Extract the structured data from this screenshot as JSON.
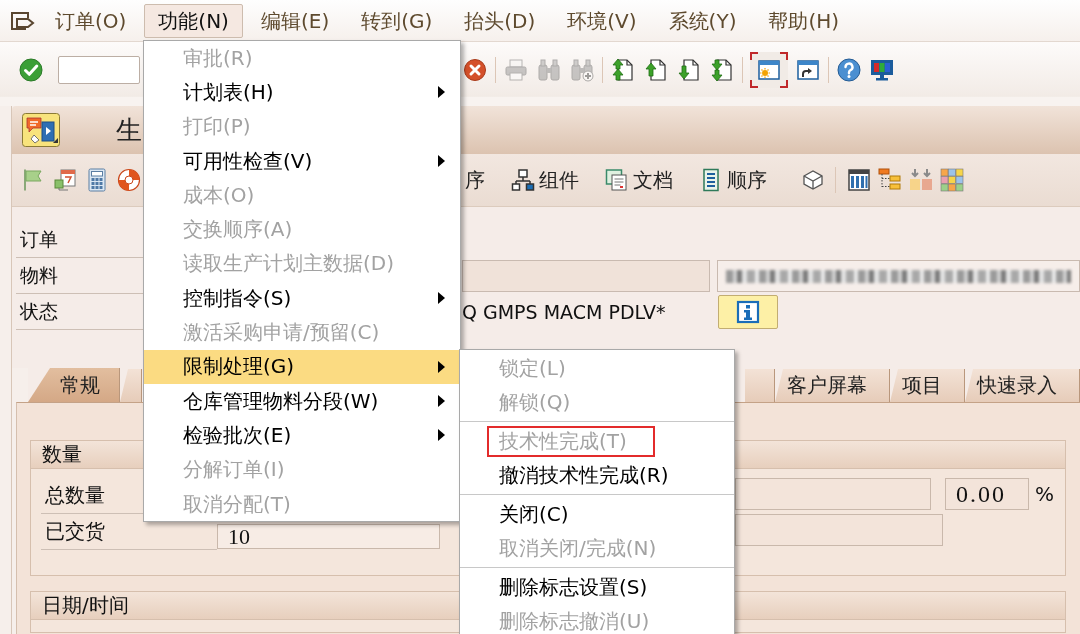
{
  "menu_bar": {
    "items": [
      {
        "label": "订单(O)",
        "selected": false
      },
      {
        "label": "功能(N)",
        "selected": true
      },
      {
        "label": "编辑(E)",
        "selected": false
      },
      {
        "label": "转到(G)",
        "selected": false
      },
      {
        "label": "抬头(D)",
        "selected": false
      },
      {
        "label": "环境(V)",
        "selected": false
      },
      {
        "label": "系统(Y)",
        "selected": false
      },
      {
        "label": "帮助(H)",
        "selected": false
      }
    ]
  },
  "toolbar": {
    "left": [
      {
        "kind": "enter",
        "disabled": false,
        "focused": false
      }
    ],
    "right": [
      {
        "kind": "cancel",
        "disabled": false,
        "focused": false
      },
      {
        "kind": "separator"
      },
      {
        "kind": "print",
        "disabled": true,
        "focused": false
      },
      {
        "kind": "find",
        "disabled": true,
        "focused": false
      },
      {
        "kind": "find-next",
        "disabled": true,
        "focused": false
      },
      {
        "kind": "separator"
      },
      {
        "kind": "first-page",
        "disabled": false,
        "focused": false
      },
      {
        "kind": "previous-page",
        "disabled": false,
        "focused": false
      },
      {
        "kind": "next-page",
        "disabled": false,
        "focused": false
      },
      {
        "kind": "last-page",
        "disabled": false,
        "focused": false
      },
      {
        "kind": "separator"
      },
      {
        "kind": "new-session",
        "disabled": false,
        "focused": true
      },
      {
        "kind": "shortcut",
        "disabled": false,
        "focused": false
      },
      {
        "kind": "separator"
      },
      {
        "kind": "help",
        "disabled": false,
        "focused": false
      },
      {
        "kind": "layout",
        "disabled": false,
        "focused": false
      }
    ]
  },
  "title_bar": {
    "title": "生"
  },
  "application_toolbar": {
    "left": [
      {
        "kind": "flag"
      },
      {
        "kind": "calendar-doc"
      },
      {
        "kind": "calculator"
      },
      {
        "kind": "lifebuoy"
      }
    ],
    "right": [
      {
        "kind": "text",
        "label": "序"
      },
      {
        "kind": "components",
        "label": "组件"
      },
      {
        "kind": "documents",
        "label": "文档"
      },
      {
        "kind": "sequence",
        "label": "顺序"
      },
      {
        "kind": "cube"
      },
      {
        "kind": "separator"
      },
      {
        "kind": "columns"
      },
      {
        "kind": "hierarchy"
      },
      {
        "kind": "arrows"
      },
      {
        "kind": "grid"
      }
    ]
  },
  "header": {
    "rows": [
      {
        "kind": "blank",
        "label": "订单"
      },
      {
        "kind": "fields",
        "label": "物料"
      },
      {
        "kind": "status",
        "label": "状态",
        "value": "Q GMPS MACM PDLV*"
      }
    ]
  },
  "tabs": [
    {
      "label": "常规",
      "selected": true
    },
    {
      "selected": false
    },
    {
      "selected": false
    },
    {
      "label": "客户屏幕",
      "selected": false
    },
    {
      "label": "项目",
      "selected": false
    },
    {
      "label": "快速录入",
      "selected": false
    }
  ],
  "quantity_group": {
    "title": "数量",
    "rows": [
      {
        "kind": "ratio",
        "label": "总数量",
        "value": "0.00",
        "unit": "%"
      },
      {
        "kind": "amount",
        "label": "已交货",
        "value": "10"
      }
    ]
  },
  "date_group": {
    "title": "日期/时间"
  },
  "function_menu": {
    "items": [
      {
        "label": "审批(R)",
        "disabled": true,
        "has_submenu": false,
        "selected": false
      },
      {
        "label": "计划表(H)",
        "disabled": false,
        "has_submenu": true,
        "selected": false
      },
      {
        "label": "打印(P)",
        "disabled": true,
        "has_submenu": false,
        "selected": false
      },
      {
        "label": "可用性检查(V)",
        "disabled": false,
        "has_submenu": true,
        "selected": false
      },
      {
        "label": "成本(O)",
        "disabled": true,
        "has_submenu": false,
        "selected": false
      },
      {
        "label": "交换顺序(A)",
        "disabled": true,
        "has_submenu": false,
        "selected": false
      },
      {
        "label": "读取生产计划主数据(D)",
        "disabled": true,
        "has_submenu": false,
        "selected": false
      },
      {
        "label": "控制指令(S)",
        "disabled": false,
        "has_submenu": true,
        "selected": false
      },
      {
        "label": "激活采购申请/预留(C)",
        "disabled": true,
        "has_submenu": false,
        "selected": false
      },
      {
        "label": "限制处理(G)",
        "disabled": false,
        "has_submenu": true,
        "selected": true,
        "submenu": {
          "groups": [
            {
              "items": [
                {
                  "label": "锁定(L)",
                  "disabled": true,
                  "marked": false
                },
                {
                  "label": "解锁(Q)",
                  "disabled": true,
                  "marked": false
                }
              ]
            },
            {
              "items": [
                {
                  "label": "技术性完成(T)",
                  "disabled": true,
                  "marked": true
                },
                {
                  "label": "撤消技术性完成(R)",
                  "disabled": false,
                  "marked": false
                }
              ]
            },
            {
              "items": [
                {
                  "label": "关闭(C)",
                  "disabled": false,
                  "marked": false
                },
                {
                  "label": "取消关闭/完成(N)",
                  "disabled": true,
                  "marked": false
                }
              ]
            },
            {
              "items": [
                {
                  "label": "删除标志设置(S)",
                  "disabled": false,
                  "marked": false
                },
                {
                  "label": "删除标志撤消(U)",
                  "disabled": true,
                  "marked": false
                }
              ]
            }
          ]
        }
      },
      {
        "label": "仓库管理物料分段(W)",
        "disabled": false,
        "has_submenu": true,
        "selected": false
      },
      {
        "label": "检验批次(E)",
        "disabled": false,
        "has_submenu": true,
        "selected": false
      },
      {
        "label": "分解订单(I)",
        "disabled": true,
        "has_submenu": false,
        "selected": false
      },
      {
        "label": "取消分配(T)",
        "disabled": true,
        "has_submenu": false,
        "selected": false
      }
    ]
  }
}
